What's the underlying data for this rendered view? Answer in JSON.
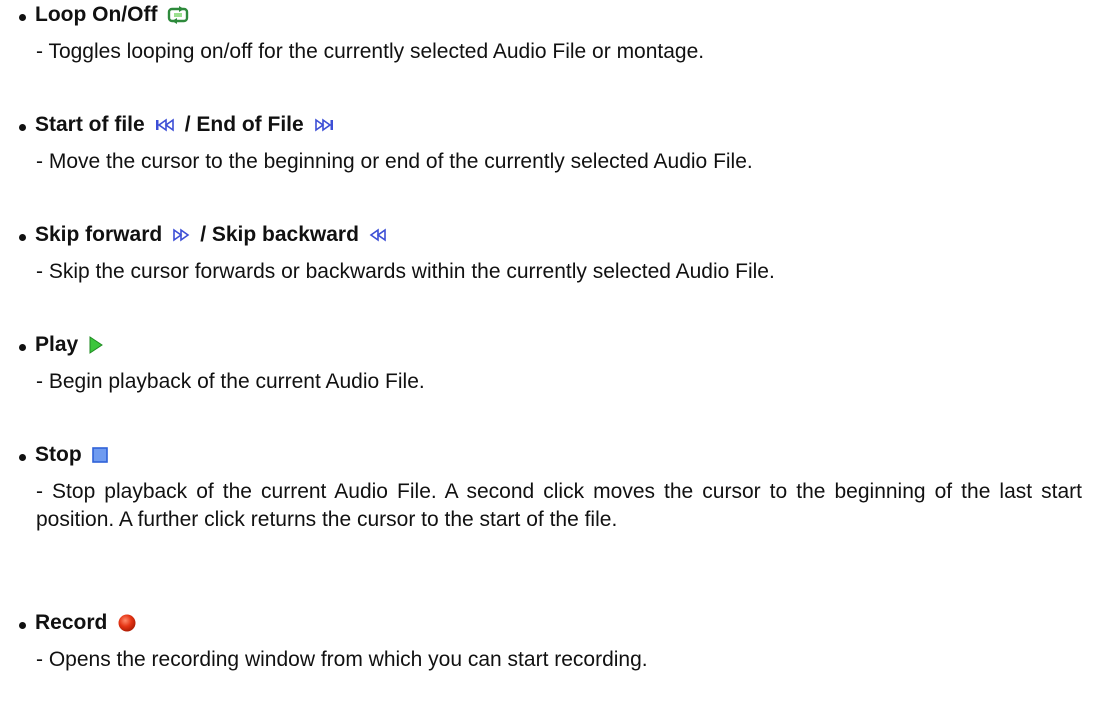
{
  "items": [
    {
      "label_1": "Loop On/Off",
      "icon_1": "loop-icon",
      "description": "- Toggles looping on/off for the currently selected Audio File or montage."
    },
    {
      "label_1": "Start of file",
      "icon_1": "start-of-file-icon",
      "label_2": "/ End of File",
      "icon_2": "end-of-file-icon",
      "description": "- Move the cursor to the beginning or end of the currently selected Audio File."
    },
    {
      "label_1": "Skip forward",
      "icon_1": "skip-forward-icon",
      "label_2": "/ Skip backward",
      "icon_2": "skip-backward-icon",
      "description": "- Skip the cursor forwards or backwards within the currently selected Audio File."
    },
    {
      "label_1": "Play",
      "icon_1": "play-icon",
      "description": "- Begin playback of the current Audio File."
    },
    {
      "label_1": "Stop",
      "icon_1": "stop-icon",
      "description": "- Stop playback of the current Audio File.  A second click moves the cursor to the beginning of the last start position. A further click returns the cursor to the start of the file."
    },
    {
      "label_1": "Record",
      "icon_1": "record-icon",
      "description": "- Opens the recording window from which you can start recording."
    }
  ],
  "colors": {
    "text": "#111111",
    "loop_icon": "#2e8a3c",
    "transport_icon": "#3d4fd6",
    "play_icon": "#3cc63c",
    "stop_icon": "#2f62d8",
    "record_icon": "#e53414"
  }
}
